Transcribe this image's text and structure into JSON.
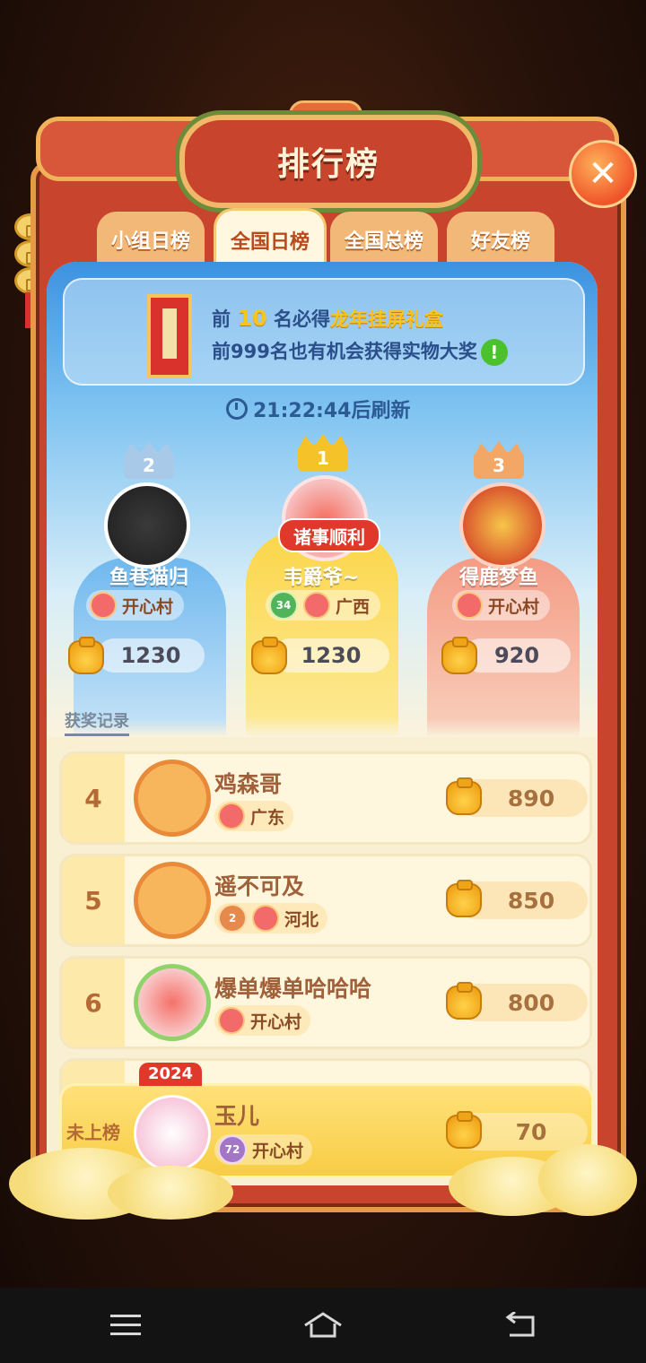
{
  "header": {
    "title": "排行榜",
    "close_glyph": "✕"
  },
  "tabs": [
    {
      "label": "小组日榜",
      "active": false
    },
    {
      "label": "全国日榜",
      "active": true
    },
    {
      "label": "全国总榜",
      "active": false
    },
    {
      "label": "好友榜",
      "active": false
    }
  ],
  "banner": {
    "line1_prefix": "前 ",
    "line1_number": "10",
    "line1_middle": " 名必得",
    "line1_prize": "龙年挂屏礼盒",
    "line2": "前999名也有机会获得实物大奖",
    "info_glyph": "!"
  },
  "refresh_text": "21:22:44后刷新",
  "podium": [
    {
      "rank": "2",
      "name": "鱼巷猫归",
      "region": "开心村",
      "level": "",
      "score": "1230",
      "color": "#6fb8ee"
    },
    {
      "rank": "1",
      "name": "韦爵爷~",
      "region": "广西",
      "level": "34",
      "score": "1230",
      "color": "#fbd64a",
      "avatar_tag": "诸事顺利"
    },
    {
      "rank": "3",
      "name": "得鹿梦鱼",
      "region": "开心村",
      "level": "",
      "score": "920",
      "color": "#f49c86"
    }
  ],
  "history_link": "获奖记录",
  "list": [
    {
      "rank": "4",
      "name": "鸡森哥",
      "region": "广东",
      "level": "",
      "score": "890"
    },
    {
      "rank": "5",
      "name": "遥不可及",
      "region": "河北",
      "level": "2",
      "score": "850"
    },
    {
      "rank": "6",
      "name": "爆单爆单哈哈哈",
      "region": "开心村",
      "level": "",
      "score": "800"
    }
  ],
  "self_row": {
    "rank_label": "未上榜",
    "name": "玉儿",
    "region": "开心村",
    "level": "72",
    "score": "70",
    "avatar_tag": "2024"
  },
  "colors": {
    "frame": "#c8442c",
    "gold": "#f8c51e",
    "panel": "#f9efd2"
  }
}
